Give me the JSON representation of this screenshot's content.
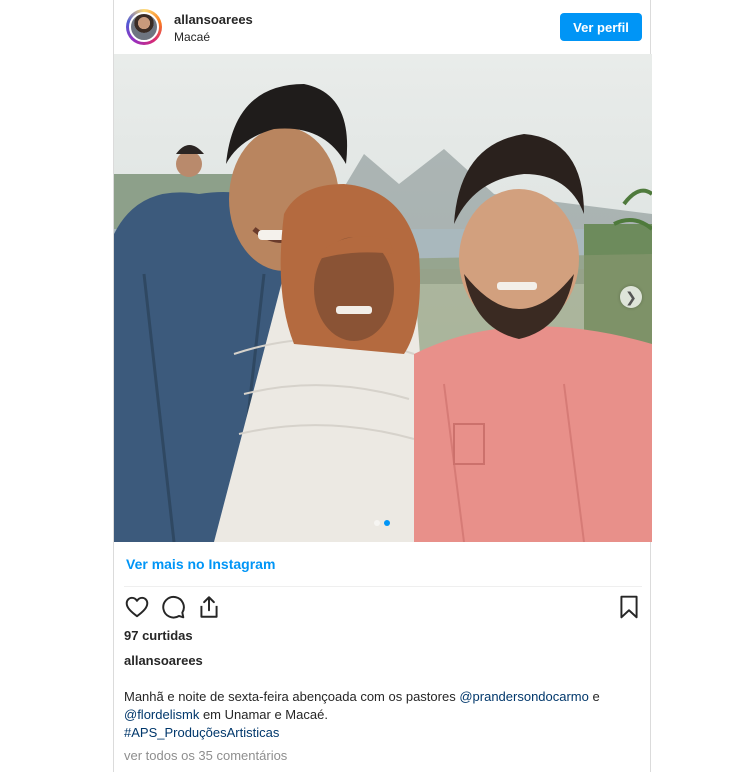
{
  "post": {
    "username": "allansoarees",
    "location": "Macaé",
    "view_profile_label": "Ver perfil",
    "view_more_label": "Ver mais no Instagram",
    "likes_text": "97 curtidas",
    "caption_username": "allansoarees",
    "caption_line1_text": "Manhã e noite de sexta-feira abençoada com os pastores ",
    "caption_mention1": "@prandersondocarmo",
    "caption_line1_end": " e",
    "caption_mention2": "@flordelismk",
    "caption_line2_text": " em Unamar e Macaé.",
    "caption_hashtag": "#APS_ProduçõesArtisticas",
    "comments_link": "ver todos os 35 comentários",
    "carousel": {
      "slides": 2,
      "active_slide": 2
    }
  },
  "icons": {
    "like": "heart-outline-icon",
    "comment": "comment-bubble-icon",
    "share": "share-icon",
    "save": "bookmark-icon",
    "next": "chevron-right-icon"
  },
  "colors": {
    "accent": "#0095f6",
    "mention": "#00376b",
    "muted": "#8e8e8e"
  }
}
